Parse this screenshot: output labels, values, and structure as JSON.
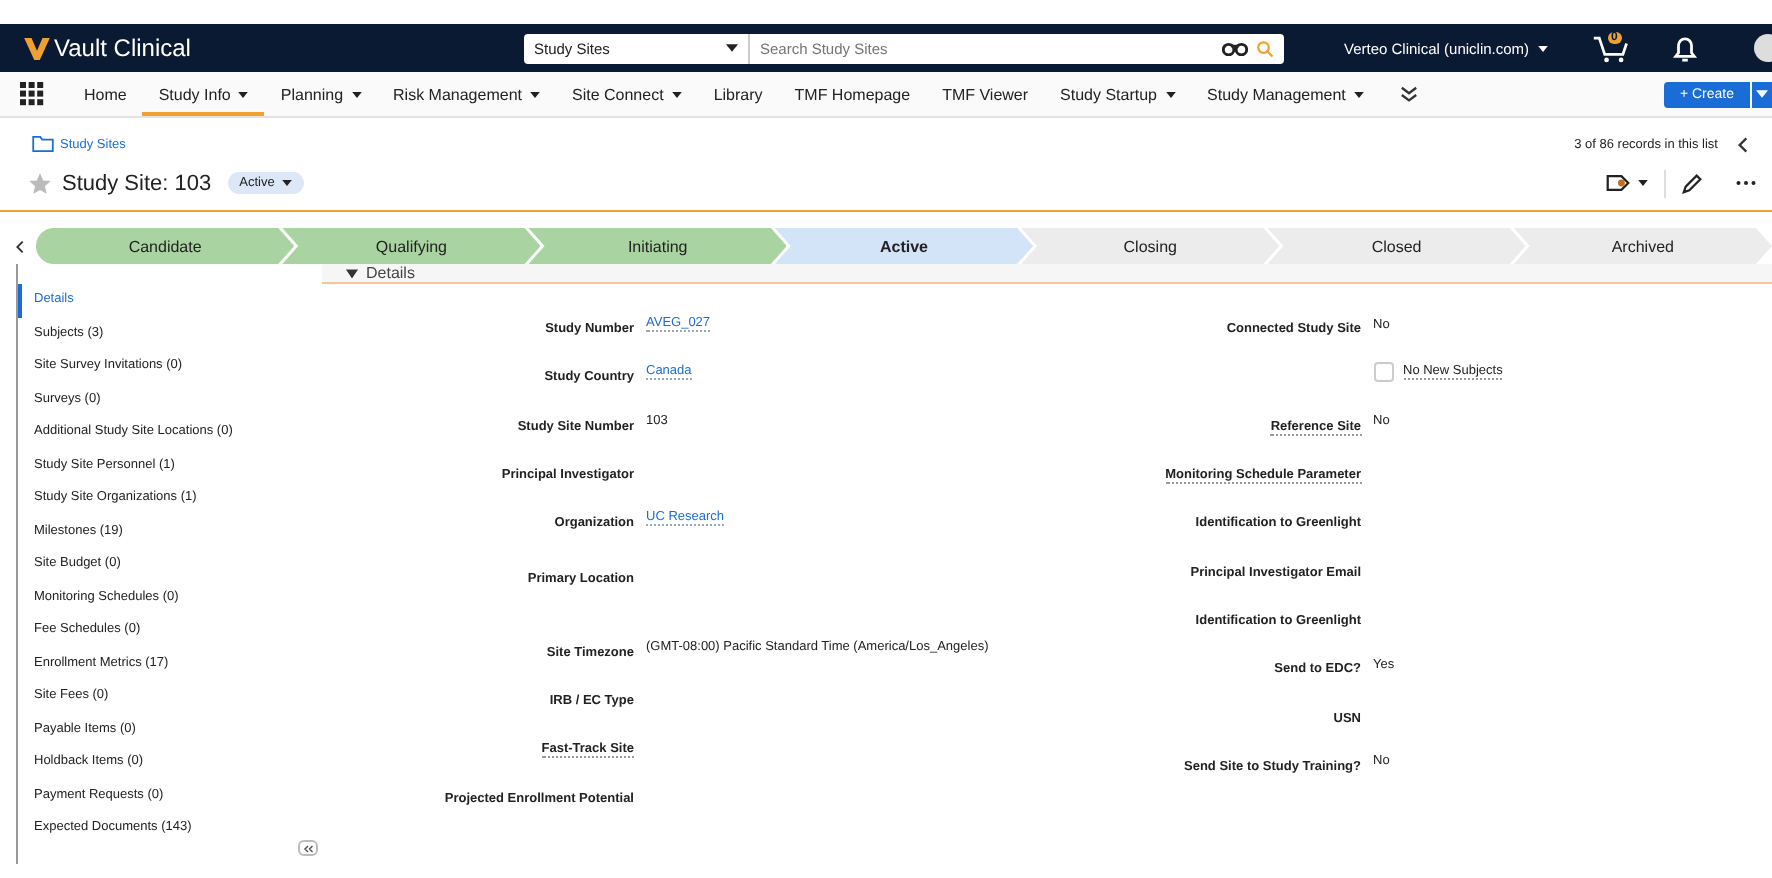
{
  "top_bar": {
    "logo": "Vault Clinical",
    "search_scope": "Study Sites",
    "search": {
      "placeholder": "Search Study Sites"
    },
    "vault": "Verteo Clinical (uniclin.com)",
    "cart_count": "0"
  },
  "nav": {
    "items": [
      {
        "label": "Home",
        "dropdown": false,
        "selected": false
      },
      {
        "label": "Study Info",
        "dropdown": true,
        "selected": true
      },
      {
        "label": "Planning",
        "dropdown": true,
        "selected": false
      },
      {
        "label": "Risk Management",
        "dropdown": true,
        "selected": false
      },
      {
        "label": "Site Connect",
        "dropdown": true,
        "selected": false
      },
      {
        "label": "Library",
        "dropdown": false,
        "selected": false
      },
      {
        "label": "TMF Homepage",
        "dropdown": false,
        "selected": false
      },
      {
        "label": "TMF Viewer",
        "dropdown": false,
        "selected": false
      },
      {
        "label": "Study Startup",
        "dropdown": true,
        "selected": false
      },
      {
        "label": "Study Management",
        "dropdown": true,
        "selected": false
      }
    ],
    "create_button": "+ Create"
  },
  "breadcrumb": "Study Sites",
  "record_count": "3 of 86 records in this list",
  "record": {
    "title": "Study Site: 103",
    "status": "Active"
  },
  "stages": [
    {
      "label": "Candidate",
      "completed": true,
      "selected": false
    },
    {
      "label": "Qualifying",
      "completed": true,
      "selected": false
    },
    {
      "label": "Initiating",
      "completed": true,
      "selected": false
    },
    {
      "label": "Active",
      "completed": false,
      "selected": true
    },
    {
      "label": "Closing",
      "completed": false,
      "selected": false
    },
    {
      "label": "Closed",
      "completed": false,
      "selected": false
    },
    {
      "label": "Archived",
      "completed": false,
      "selected": false
    }
  ],
  "sidebar": {
    "items": [
      {
        "label": "Details",
        "selected": true
      },
      {
        "label": "Subjects (3)",
        "selected": false
      },
      {
        "label": "Site Survey Invitations (0)",
        "selected": false
      },
      {
        "label": "Surveys (0)",
        "selected": false
      },
      {
        "label": "Additional Study Site Locations (0)",
        "selected": false
      },
      {
        "label": "Study Site Personnel (1)",
        "selected": false
      },
      {
        "label": "Study Site Organizations (1)",
        "selected": false
      },
      {
        "label": "Milestones (19)",
        "selected": false
      },
      {
        "label": "Site Budget (0)",
        "selected": false
      },
      {
        "label": "Monitoring Schedules (0)",
        "selected": false
      },
      {
        "label": "Fee Schedules (0)",
        "selected": false
      },
      {
        "label": "Enrollment Metrics (17)",
        "selected": false
      },
      {
        "label": "Site Fees (0)",
        "selected": false
      },
      {
        "label": "Payable Items (0)",
        "selected": false
      },
      {
        "label": "Holdback Items (0)",
        "selected": false
      },
      {
        "label": "Payment Requests (0)",
        "selected": false
      },
      {
        "label": "Expected Documents (143)",
        "selected": false
      }
    ]
  },
  "section": {
    "title": "Details",
    "expanded": true,
    "left_fields": [
      {
        "kind": "link",
        "label": "Study Number",
        "value": "AVEG_027",
        "help": false
      },
      {
        "kind": "link",
        "label": "Study Country",
        "value": "Canada",
        "help": false
      },
      {
        "kind": "text",
        "label": "Study Site Number",
        "value": "103",
        "help": false
      },
      {
        "kind": "empty",
        "label": "Principal Investigator",
        "help": false
      },
      {
        "kind": "link",
        "label": "Organization",
        "value": "UC Research",
        "help": false
      },
      {
        "kind": "tall",
        "label": "Primary Location",
        "help": false
      },
      {
        "kind": "text",
        "label": "Site Timezone",
        "value": "(GMT-08:00) Pacific Standard Time (America/Los_Angeles)",
        "help": false
      },
      {
        "kind": "empty",
        "label": "IRB / EC Type",
        "help": false
      },
      {
        "kind": "empty",
        "label": "Fast-Track Site",
        "help": true
      },
      {
        "kind": "empty",
        "label": "Projected Enrollment Potential",
        "help": false
      }
    ],
    "right_fields": [
      {
        "kind": "text",
        "label": "Connected Study Site",
        "value": "No",
        "help": false
      },
      {
        "kind": "checkbox",
        "label": "No New Subjects",
        "checked": false,
        "help": true
      },
      {
        "kind": "text",
        "label": "Reference Site",
        "value": "No",
        "help": true
      },
      {
        "kind": "empty",
        "label": "Monitoring Schedule Parameter",
        "help": true
      },
      {
        "kind": "empty",
        "label": "Identification to Greenlight",
        "help": false
      },
      {
        "kind": "empty",
        "label": "Principal Investigator Email",
        "help": false
      },
      {
        "kind": "empty",
        "label": "Identification to Greenlight",
        "help": false
      },
      {
        "kind": "text",
        "label": "Send to EDC?",
        "value": "Yes",
        "help": false
      },
      {
        "kind": "empty",
        "label": "USN",
        "help": false
      },
      {
        "kind": "text",
        "label": "Send Site to Study Training?",
        "value": "No",
        "help": false
      }
    ]
  }
}
